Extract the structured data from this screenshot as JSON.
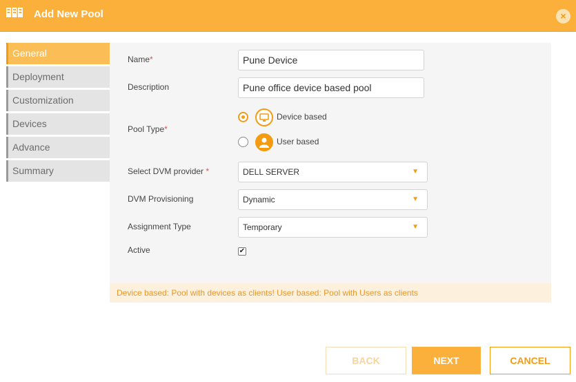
{
  "dialog": {
    "title": "Add New Pool",
    "close_label": "×"
  },
  "sidebar": {
    "items": [
      {
        "label": "General"
      },
      {
        "label": "Deployment"
      },
      {
        "label": "Customization"
      },
      {
        "label": "Devices"
      },
      {
        "label": "Advance"
      },
      {
        "label": "Summary"
      }
    ]
  },
  "form": {
    "name": {
      "label": "Name",
      "required_mark": "*",
      "value": "Pune Device"
    },
    "description": {
      "label": "Description",
      "value": "Pune office device based pool"
    },
    "pool_type": {
      "label": "Pool Type",
      "required_mark": "*",
      "options": [
        {
          "label": "Device based"
        },
        {
          "label": "User based"
        }
      ],
      "selected": "Device based"
    },
    "dvm_provider": {
      "label": "Select DVM provider ",
      "required_mark": "*",
      "value": "DELL SERVER"
    },
    "dvm_provisioning": {
      "label": "DVM Provisioning",
      "value": "Dynamic"
    },
    "assignment_type": {
      "label": "Assignment Type",
      "value": "Temporary"
    },
    "active": {
      "label": "Active",
      "checked": true,
      "check_mark": "✔"
    }
  },
  "info_text": "Device based: Pool with devices as clients! User based: Pool with Users as clients",
  "buttons": {
    "back": "BACK",
    "next": "NEXT",
    "cancel": "CANCEL"
  },
  "colors": {
    "accent": "#fbb03b",
    "accent_dark": "#f39c12",
    "info_bg": "#fdf0dc"
  }
}
